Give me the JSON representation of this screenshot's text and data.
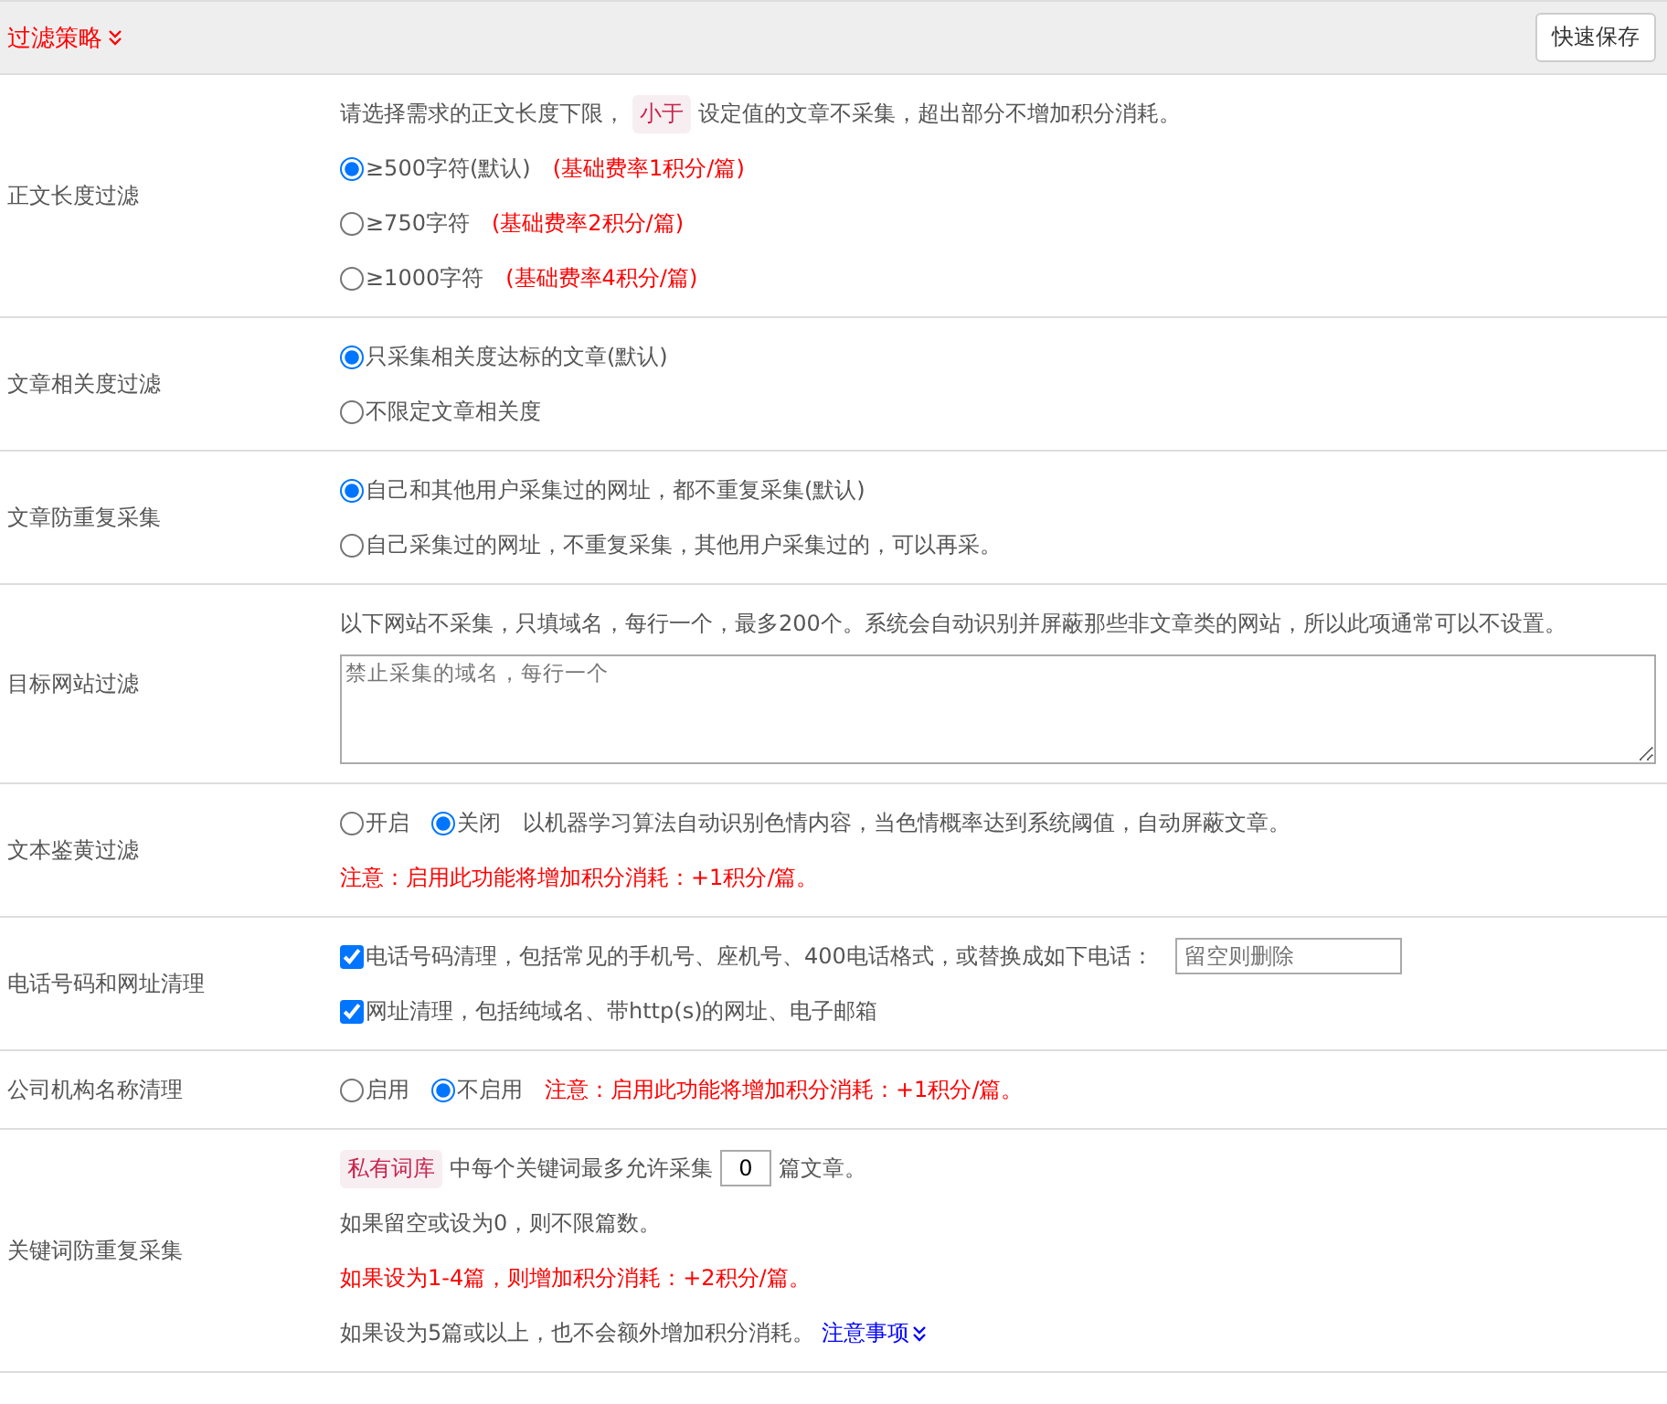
{
  "header": {
    "title": "过滤策略",
    "save_button": "快速保存"
  },
  "rows": [
    {
      "label": "正文长度过滤",
      "lines": [
        [
          {
            "kind": "text",
            "text": "请选择需求的正文长度下限，"
          },
          {
            "kind": "tag",
            "text": "小于"
          },
          {
            "kind": "text",
            "text": "设定值的文章不采集，超出部分不增加积分消耗。"
          }
        ],
        [
          {
            "kind": "radio",
            "text": "≥500字符(默认)",
            "selected": true
          },
          {
            "kind": "red",
            "text": "(基础费率1积分/篇)"
          }
        ],
        [
          {
            "kind": "radio",
            "text": "≥750字符",
            "selected": false
          },
          {
            "kind": "red",
            "text": "(基础费率2积分/篇)"
          }
        ],
        [
          {
            "kind": "radio",
            "text": "≥1000字符",
            "selected": false
          },
          {
            "kind": "red",
            "text": "(基础费率4积分/篇)"
          }
        ]
      ]
    },
    {
      "label": "文章相关度过滤",
      "lines": [
        [
          {
            "kind": "radio",
            "text": "只采集相关度达标的文章(默认)",
            "selected": true
          }
        ],
        [
          {
            "kind": "radio",
            "text": "不限定文章相关度",
            "selected": false
          }
        ]
      ]
    },
    {
      "label": "文章防重复采集",
      "lines": [
        [
          {
            "kind": "radio",
            "text": "自己和其他用户采集过的网址，都不重复采集(默认)",
            "selected": true
          }
        ],
        [
          {
            "kind": "radio",
            "text": "自己采集过的网址，不重复采集，其他用户采集过的，可以再采。",
            "selected": false
          }
        ]
      ]
    },
    {
      "label": "目标网站过滤",
      "lines": [
        [
          {
            "kind": "text",
            "text": "以下网站不采集，只填域名，每行一个，最多200个。系统会自动识别并屏蔽那些非文章类的网站，所以此项通常可以不设置。"
          }
        ],
        [
          {
            "kind": "textarea",
            "placeholder": "禁止采集的域名，每行一个"
          }
        ]
      ]
    },
    {
      "label": "文本鉴黄过滤",
      "lines": [
        [
          {
            "kind": "radio",
            "text": "开启",
            "selected": false
          },
          {
            "kind": "radio",
            "text": "关闭",
            "selected": true
          },
          {
            "kind": "text",
            "text": "以机器学习算法自动识别色情内容，当色情概率达到系统阈值，自动屏蔽文章。"
          }
        ],
        [
          {
            "kind": "red",
            "text": "注意：启用此功能将增加积分消耗：+1积分/篇。"
          }
        ]
      ]
    },
    {
      "label": "电话号码和网址清理",
      "lines": [
        [
          {
            "kind": "checkbox",
            "text": "电话号码清理，包括常见的手机号、座机号、400电话格式，或替换成如下电话：",
            "checked": true
          },
          {
            "kind": "input",
            "placeholder": "留空则删除"
          }
        ],
        [
          {
            "kind": "checkbox",
            "text": "网址清理，包括纯域名、带http(s)的网址、电子邮箱",
            "checked": true
          }
        ]
      ]
    },
    {
      "label": "公司机构名称清理",
      "lines": [
        [
          {
            "kind": "radio",
            "text": "启用",
            "selected": false
          },
          {
            "kind": "radio",
            "text": "不启用",
            "selected": true
          },
          {
            "kind": "red",
            "text": "注意：启用此功能将增加积分消耗：+1积分/篇。"
          }
        ]
      ]
    },
    {
      "label": "关键词防重复采集",
      "lines": [
        [
          {
            "kind": "tag",
            "text": "私有词库"
          },
          {
            "kind": "text",
            "text": "中每个关键词最多允许采集"
          },
          {
            "kind": "number",
            "value": "0"
          },
          {
            "kind": "text",
            "text": "篇文章。"
          }
        ],
        [
          {
            "kind": "text",
            "text": "如果留空或设为0，则不限篇数。"
          }
        ],
        [
          {
            "kind": "red",
            "text": "如果设为1-4篇，则增加积分消耗：+2积分/篇。"
          }
        ],
        [
          {
            "kind": "text",
            "text": "如果设为5篇或以上，也不会额外增加积分消耗。"
          },
          {
            "kind": "link",
            "text": "注意事项"
          }
        ]
      ]
    }
  ]
}
